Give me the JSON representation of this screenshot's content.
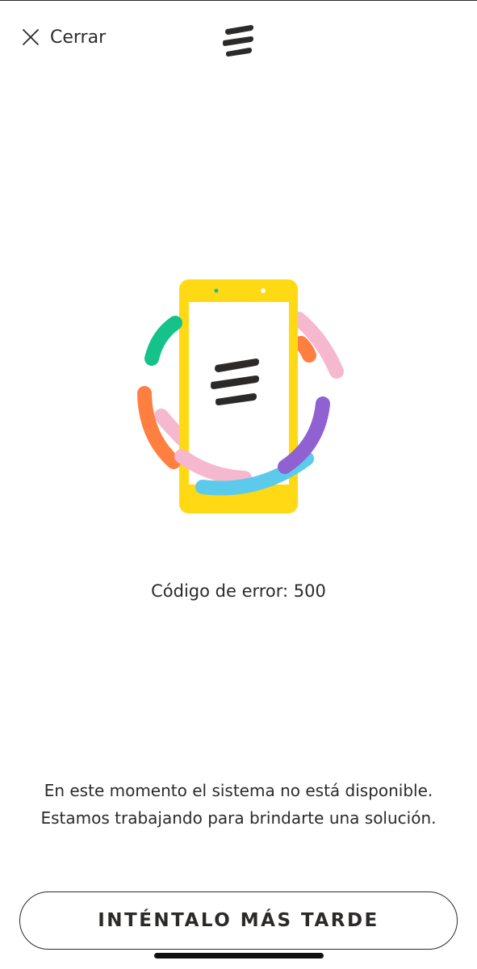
{
  "header": {
    "close_label": "Cerrar",
    "close_icon": "close-icon",
    "logo_icon": "brand-logo-icon"
  },
  "illustration": {
    "icon": "phone-error-illustration",
    "colors": {
      "phone": "#FFD914",
      "screen": "#FFFFFF",
      "green": "#14C28A",
      "orange": "#FF7F41",
      "pink": "#F5B8CF",
      "purple": "#9061D1",
      "blue": "#5CCBEB",
      "dark": "#2C2A29"
    }
  },
  "error": {
    "code_text": "Código de error: 500"
  },
  "message": {
    "line1": "En este momento el sistema no está disponible.",
    "line2": "Estamos trabajando para brindarte una solución."
  },
  "actions": {
    "retry_label": "INTÉNTALO MÁS TARDE"
  }
}
